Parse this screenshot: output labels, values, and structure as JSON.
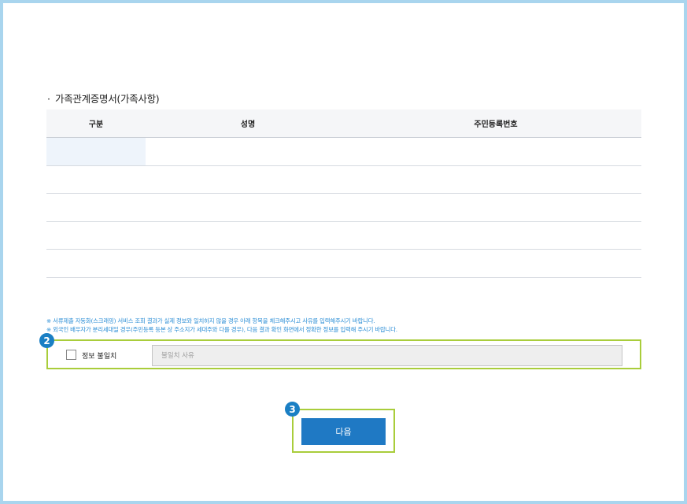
{
  "section": {
    "bullet": "·",
    "title": "가족관계증명서(가족사항)"
  },
  "table": {
    "headers": [
      "구분",
      "성명",
      "주민등록번호"
    ],
    "rows": [
      [
        "",
        "",
        ""
      ],
      [
        "",
        "",
        ""
      ],
      [
        "",
        "",
        ""
      ],
      [
        "",
        "",
        ""
      ],
      [
        "",
        "",
        ""
      ]
    ]
  },
  "notice": {
    "line1": "※ 서류제출 자동화(스크래핑) 서비스 조회 결과가 실제 정보와 일치하지 않을 경우 아래 항목을 체크해주시고 사유를 입력해주시기 바랍니다.",
    "line2": "※ 외국인 배우자가 분리세대일 경우(주민등록 등본 상 주소지가 세대주와 다를 경우), 다음 결과 확인 화면에서 정확한 정보를 입력해 주시기 바랍니다."
  },
  "mismatch": {
    "badge": "2",
    "checkbox_label": "정보 불일치",
    "reason_placeholder": "불일치 사유",
    "reason_value": ""
  },
  "next": {
    "badge": "3",
    "label": "다음"
  },
  "colors": {
    "frame": "#a9d5ee",
    "highlight": "#a9cd3b",
    "badge": "#1a7fc4",
    "button": "#1f79c4",
    "notice": "#2b8ed6"
  }
}
